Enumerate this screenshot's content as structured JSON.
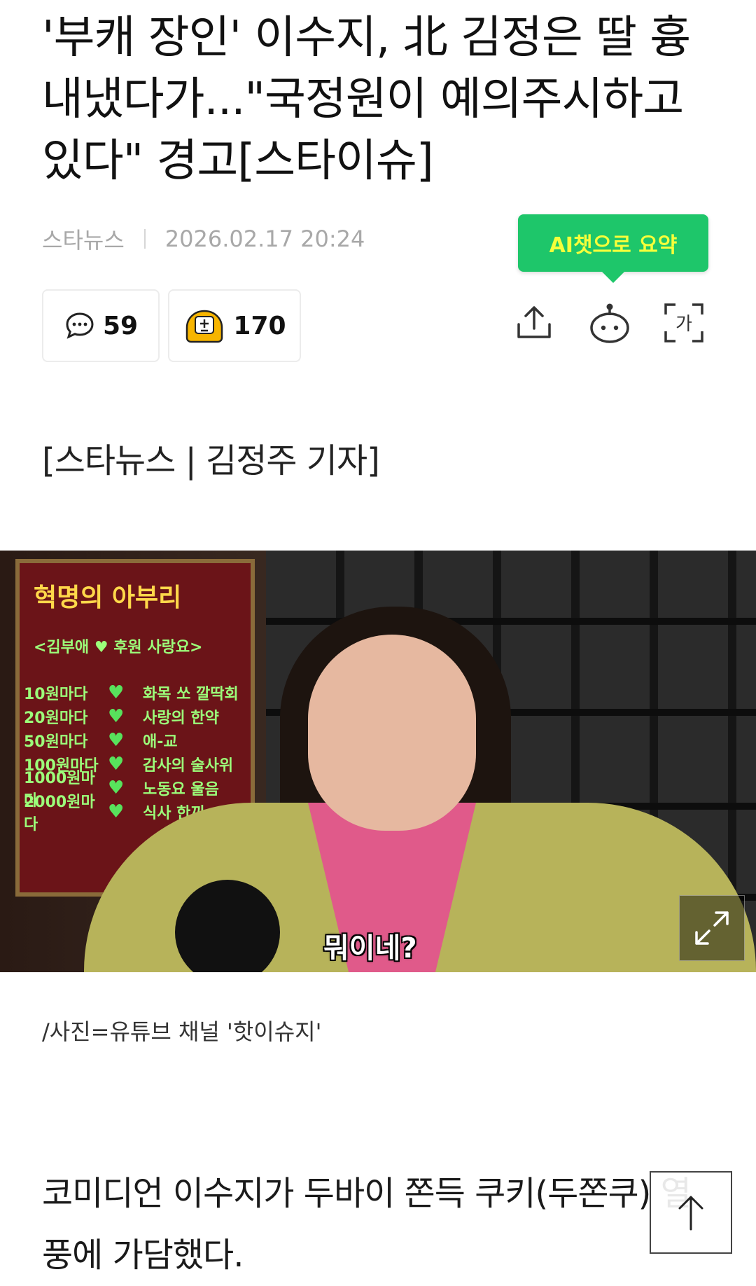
{
  "article": {
    "headline": "'부캐 장인' 이수지, 北 김정은 딸 흉내냈다가...\"국정원이 예의주시하고 있다\" 경고[스타이슈]",
    "source": "스타뉴스",
    "datetime": "2026.02.17 20:24",
    "byline": "[스타뉴스 | 김정주 기자]",
    "photo_caption": "/사진=유튜브 채널 '핫이슈지'",
    "body_first": "코미디언 이수지가 두바이 쫀득 쿠키(두쫀쿠) 열풍에 가담했다."
  },
  "actions": {
    "ai_summary_label": "AI챗으로 요약",
    "comment_count": "59",
    "reaction_count": "170",
    "icons": [
      "share-icon",
      "chat-bot-icon",
      "font-size-icon"
    ]
  },
  "photo": {
    "board_title": "혁명의 아부리",
    "board_subtitle": "<김부애 ♥ 후원 사랑요>",
    "board_rows": [
      {
        "amount": "10원마다",
        "text": "화목 쏘 깔딱회"
      },
      {
        "amount": "20원마다",
        "text": "사랑의 한약"
      },
      {
        "amount": "50원마다",
        "text": "애-교"
      },
      {
        "amount": "100원마다",
        "text": "감사의 술사위"
      },
      {
        "amount": "1000원마다",
        "text": "노동요 울음"
      },
      {
        "amount": "2000원마다",
        "text": "식사 한끼"
      }
    ],
    "subtitle_text": "뭐이네?"
  },
  "colors": {
    "ai_bubble": "#1ec66a",
    "ai_text": "#f6ff3a",
    "meta_text": "#a8a8a8"
  }
}
